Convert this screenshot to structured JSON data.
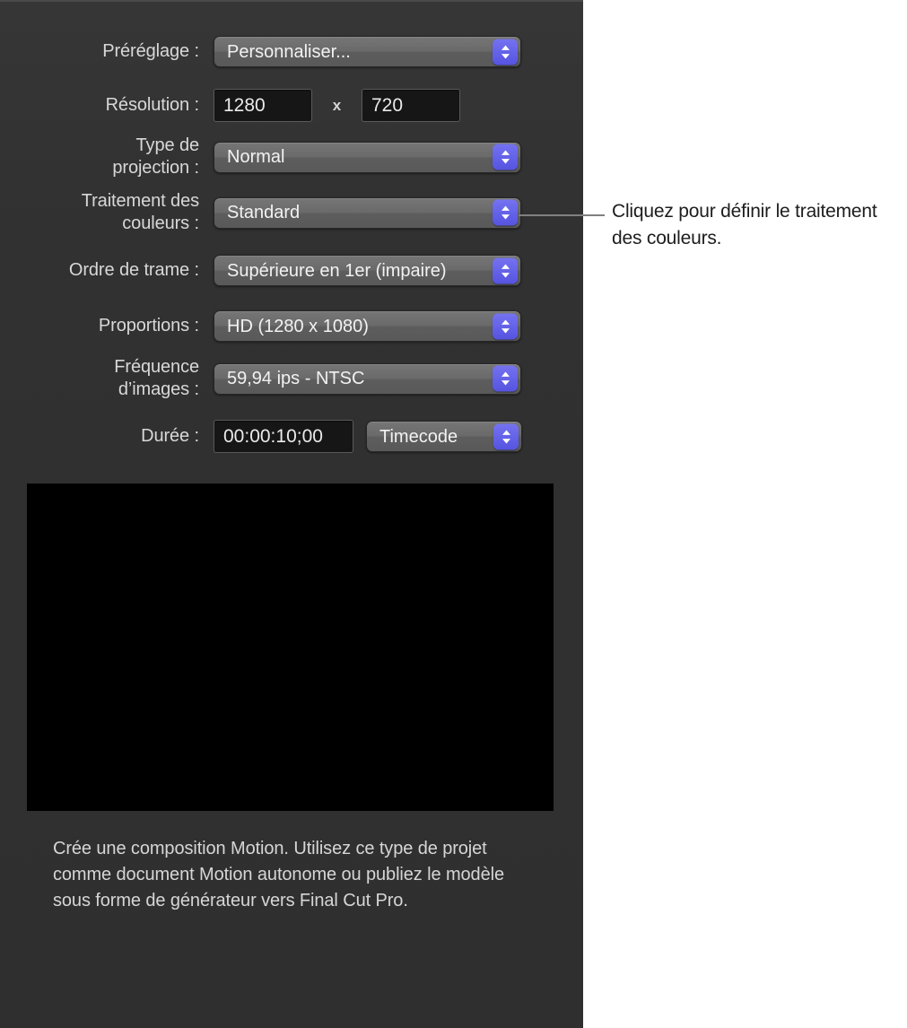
{
  "panel": {
    "rows": [
      {
        "name": "preset",
        "label": "Préréglage :",
        "control": "popup",
        "value": "Personnaliser..."
      },
      {
        "name": "resolution",
        "label": "Résolution :",
        "control": "resolution",
        "width": "1280",
        "separator": "x",
        "height": "720"
      },
      {
        "name": "projection-type",
        "label": "Type de\nprojection :",
        "control": "popup",
        "value": "Normal"
      },
      {
        "name": "color-processing",
        "label": "Traitement des\ncouleurs :",
        "control": "popup",
        "value": "Standard"
      },
      {
        "name": "field-order",
        "label": "Ordre de trame :",
        "control": "popup",
        "value": "Supérieure en 1er (impaire)"
      },
      {
        "name": "aspect-ratio",
        "label": "Proportions :",
        "control": "popup",
        "value": "HD (1280 x 1080)"
      },
      {
        "name": "frame-rate",
        "label": "Fréquence\nd’images :",
        "control": "popup",
        "value": "59,94 ips - NTSC"
      },
      {
        "name": "duration",
        "label": "Durée :",
        "control": "duration",
        "value": "00:00:10;00",
        "unit": "Timecode"
      }
    ],
    "description": "Crée une composition Motion. Utilisez ce type de projet comme document Motion autonome ou publiez le modèle sous forme de générateur vers Final Cut Pro."
  },
  "callout": {
    "text": "Cliquez pour définir le traitement des couleurs."
  },
  "colors": {
    "panel_background": "#323232",
    "accent_stepper": "#6563e8",
    "field_background": "#161616",
    "popup_background": "#6a6a6a",
    "preview_background": "#000000",
    "label_text": "#d8d8d8",
    "callout_text": "#1d1d1d",
    "callout_line": "#808080"
  },
  "icons": {
    "stepper": "chevron-up-down-icon"
  }
}
